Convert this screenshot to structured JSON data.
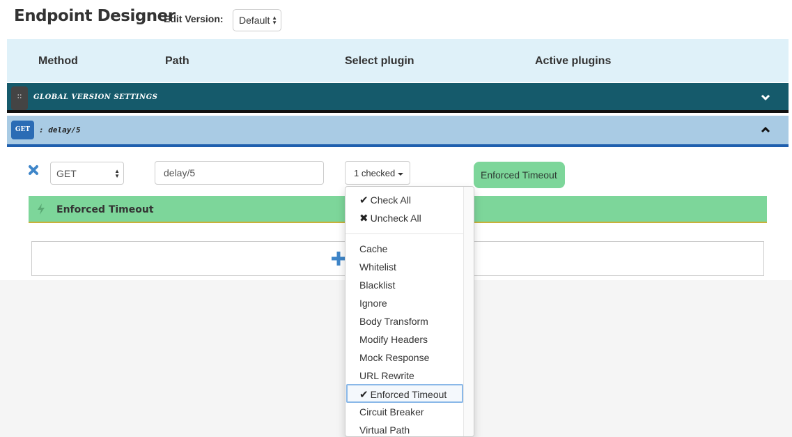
{
  "header": {
    "title": "Endpoint Designer",
    "edit_version_label": "Edit Version:",
    "version_value": "Default"
  },
  "columns": {
    "method": "Method",
    "path": "Path",
    "select_plugin": "Select plugin",
    "active_plugins": "Active plugins"
  },
  "global_settings": {
    "handle": "::",
    "label": "GLOBAL VERSION SETTINGS"
  },
  "endpoint": {
    "method_badge": "GET",
    "path_label": ": delay/5",
    "method_value": "GET",
    "path_value": "delay/5",
    "plugins_button": "1 checked",
    "active_plugin": "Enforced Timeout",
    "plugin_panel_title": "Enforced Timeout"
  },
  "dropdown": {
    "check_all": "Check All",
    "uncheck_all": "Uncheck All",
    "items": [
      "Cache",
      "Whitelist",
      "Blacklist",
      "Ignore",
      "Body Transform",
      "Modify Headers",
      "Mock Response",
      "URL Rewrite",
      "Enforced Timeout",
      "Circuit Breaker",
      "Virtual Path"
    ],
    "selected_index": 8
  },
  "icons": {
    "remove": "close-icon",
    "collapse_global": "chevron-down-icon",
    "collapse_endpoint": "chevron-up-icon",
    "plugin": "bolt-icon",
    "add": "plus-icon",
    "check": "check-icon",
    "uncheck": "close-icon"
  },
  "colors": {
    "global_bar": "#155a6b",
    "endpoint_bar": "#a9cbe4",
    "plugin_green": "#7dd69a",
    "accent_blue": "#2b6cb5"
  }
}
